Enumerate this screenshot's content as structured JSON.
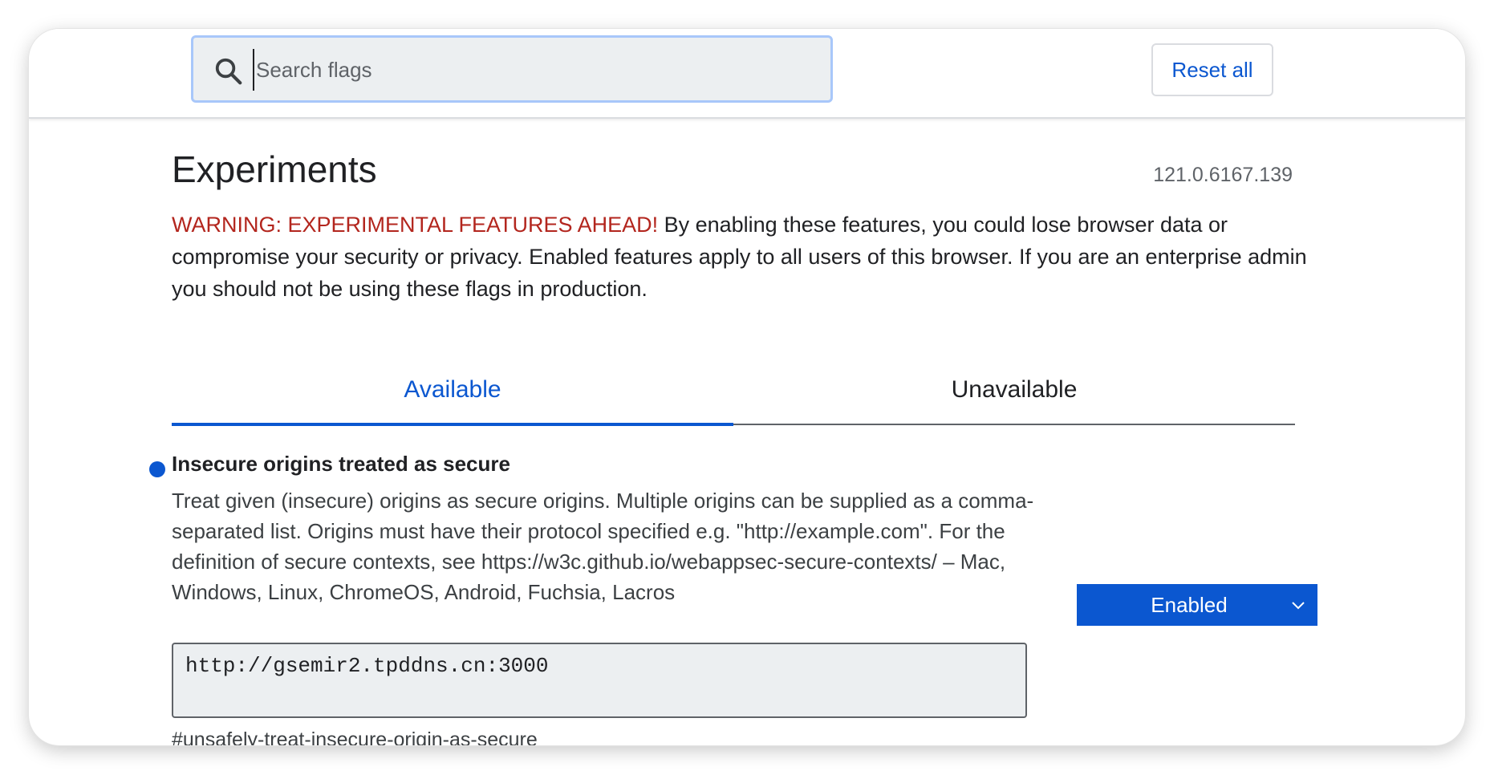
{
  "header": {
    "search_placeholder": "Search flags",
    "search_icon": "search-icon",
    "reset_label": "Reset all"
  },
  "page": {
    "title": "Experiments",
    "version": "121.0.6167.139",
    "warning_label": "WARNING: EXPERIMENTAL FEATURES AHEAD!",
    "warning_text": " By enabling these features, you could lose browser data or compromise your security or privacy. Enabled features apply to all users of this browser. If you are an enterprise admin you should not be using these flags in production."
  },
  "tabs": [
    {
      "label": "Available",
      "selected": true
    },
    {
      "label": "Unavailable",
      "selected": false
    }
  ],
  "flag": {
    "title": "Insecure origins treated as secure",
    "description": "Treat given (insecure) origins as secure origins. Multiple origins can be supplied as a comma-separated list. Origins must have their protocol specified e.g. \"http://example.com\". For the definition of secure contexts, see https://w3c.github.io/webappsec-secure-contexts/ – Mac, Windows, Linux, ChromeOS, Android, Fuchsia, Lacros",
    "value": "http://gsemir2.tpddns.cn:3000",
    "link": "#unsafely-treat-insecure-origin-as-secure",
    "state": "Enabled",
    "dot_icon": "modified-dot-icon",
    "chevron_icon": "chevron-down-icon"
  },
  "colors": {
    "accent": "#0b57d0",
    "warning": "#b3261e",
    "input_bg": "#eceff1",
    "focus_border": "#a8c7fa"
  }
}
